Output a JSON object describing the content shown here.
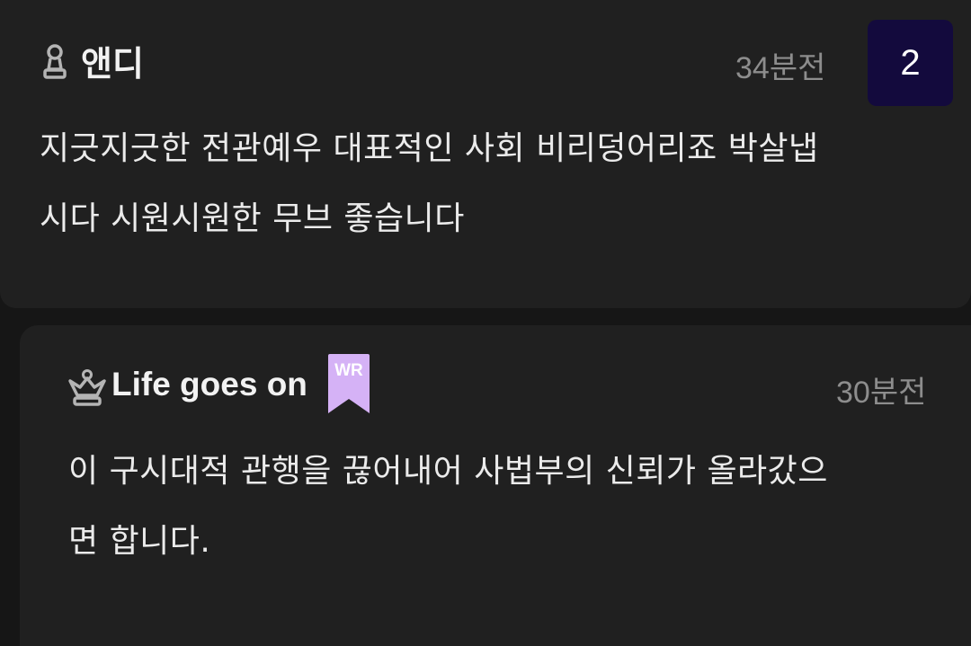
{
  "comment": {
    "author": "앤디",
    "author_icon": "pawn-icon",
    "time": "34분전",
    "reply_count": "2",
    "body_lines": [
      "지긋지긋한 전관예우 대표적인 사회 비리덩어리죠 박살냅",
      "시다 시원시원한 무브 좋습니다"
    ]
  },
  "reply": {
    "author": "Life goes on",
    "author_icon": "queen-icon",
    "badge": "WR",
    "time": "30분전",
    "body_lines": [
      "이 구시대적 관행을 끊어내어 사법부의 신뢰가 올라갔으",
      "면 합니다."
    ]
  },
  "colors": {
    "background": "#161616",
    "card": "#202020",
    "count_badge": "#130a3d",
    "wr_badge": "#d5b2f6",
    "muted_text": "#8d8d8d"
  }
}
